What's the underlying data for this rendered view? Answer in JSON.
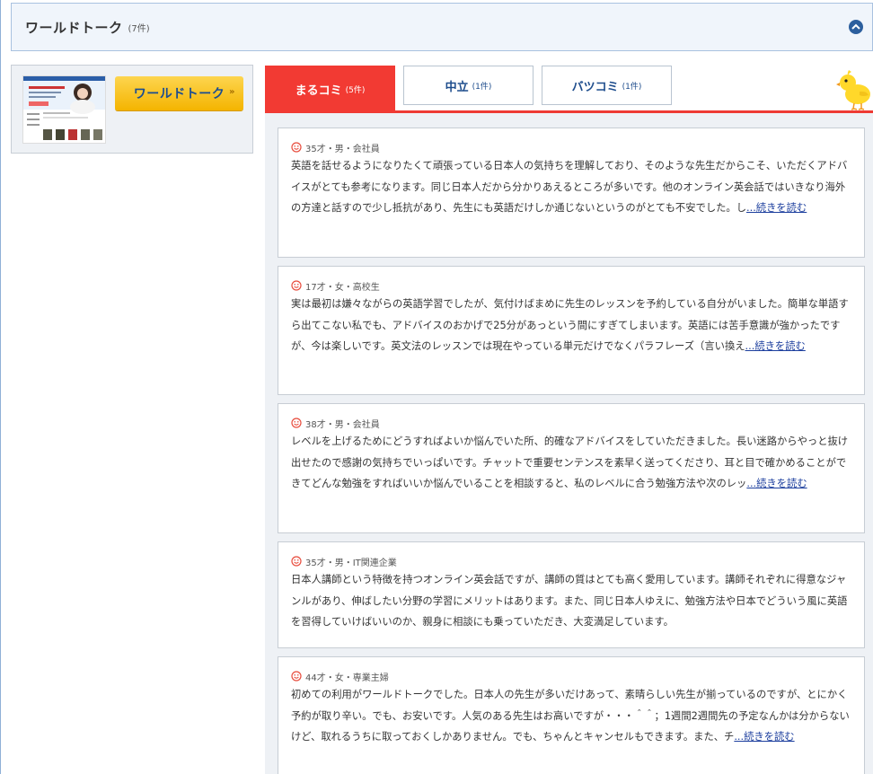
{
  "header": {
    "title": "ワールドトーク",
    "count": "(7件)"
  },
  "sidebar": {
    "cta_label": "ワールドトーク",
    "cta_arrow": "»"
  },
  "tabs": [
    {
      "label": "まるコミ",
      "count": "(5件)"
    },
    {
      "label": "中立",
      "count": "(1件)"
    },
    {
      "label": "バツコミ",
      "count": "(1件)"
    }
  ],
  "reviews": [
    {
      "meta": "35才・男・会社員",
      "text": "英語を話せるようになりたくて頑張っている日本人の気持ちを理解しており、そのような先生だからこそ、いただくアドバイスがとても参考になります。同じ日本人だから分かりあえるところが多いです。他のオンライン英会話ではいきなり海外の方達と話すので少し抵抗があり、先生にも英語だけしか通じないというのがとても不安でした。し",
      "more": "...続きを読む"
    },
    {
      "meta": "17才・女・高校生",
      "text": "実は最初は嫌々ながらの英語学習でしたが、気付けばまめに先生のレッスンを予約している自分がいました。簡単な単語すら出てこない私でも、アドバイスのおかげで25分があっという間にすぎてしまいます。英語には苦手意識が強かったですが、今は楽しいです。英文法のレッスンでは現在やっている単元だけでなくパラフレーズ（言い換え",
      "more": "...続きを読む"
    },
    {
      "meta": "38才・男・会社員",
      "text": "レベルを上げるためにどうすればよいか悩んでいた所、的確なアドバイスをしていただきました。長い迷路からやっと抜け出せたので感謝の気持ちでいっぱいです。チャットで重要センテンスを素早く送ってくださり、耳と目で確かめることができてどんな勉強をすればいいか悩んでいることを相談すると、私のレベルに合う勉強方法や次のレッ",
      "more": "...続きを読む"
    },
    {
      "meta": "35才・男・IT関連企業",
      "text": "日本人講師という特徴を持つオンライン英会話ですが、講師の質はとても高く愛用しています。講師それぞれに得意なジャンルがあり、伸ばしたい分野の学習にメリットはあります。また、同じ日本人ゆえに、勉強方法や日本でどういう風に英語を習得していけばいいのか、親身に相談にも乗っていただき、大変満足しています。",
      "more": ""
    },
    {
      "meta": "44才・女・専業主婦",
      "text": "初めての利用がワールドトークでした。日本人の先生が多いだけあって、素晴らしい先生が揃っているのですが、とにかく予約が取り辛い。でも、お安いです。人気のある先生はお高いですが・・・＾＾；1週間2週間先の予定なんかは分からないけど、取れるうちに取っておくしかありません。でも、ちゃんとキャンセルもできます。また、チ",
      "more": "...続きを読む"
    }
  ],
  "colors": {
    "accent_red": "#f23a33",
    "link_blue": "#1d4c8c",
    "smile_red": "#e84c3d"
  }
}
